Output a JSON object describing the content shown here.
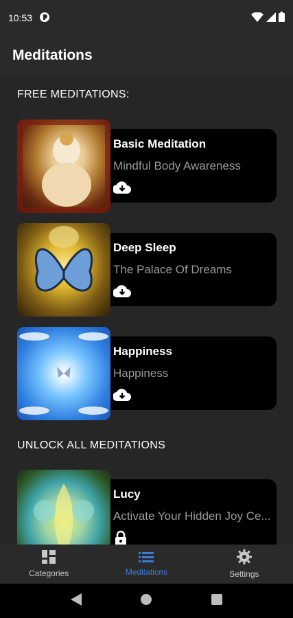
{
  "status": {
    "time": "10:53"
  },
  "app_bar": {
    "title": "Meditations"
  },
  "sections": {
    "free_title": "FREE MEDITATIONS:",
    "unlock_title": "UNLOCK ALL MEDITATIONS"
  },
  "free_meditations": [
    {
      "title": "Basic Meditation",
      "subtitle": "Mindful Body Awareness",
      "icon": "download-icon"
    },
    {
      "title": "Deep Sleep",
      "subtitle": "The Palace Of Dreams",
      "icon": "download-icon"
    },
    {
      "title": "Happiness",
      "subtitle": "Happiness",
      "icon": "download-icon"
    }
  ],
  "locked_meditations": [
    {
      "title": "Lucy",
      "subtitle": "Activate Your Hidden Joy Ce...",
      "icon": "lock-icon"
    }
  ],
  "bottom_nav": {
    "items": [
      {
        "label": "Categories",
        "icon": "grid-icon",
        "active": false
      },
      {
        "label": "Meditations",
        "icon": "list-icon",
        "active": true
      },
      {
        "label": "Settings",
        "icon": "gear-icon",
        "active": false
      }
    ]
  },
  "colors": {
    "accent": "#3d7bd9",
    "card": "#000000",
    "background": "#262626",
    "bar": "#2a2a2a"
  }
}
